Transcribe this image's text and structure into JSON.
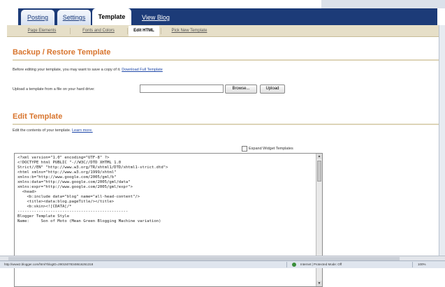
{
  "top_tabs": [
    {
      "label": "Posting"
    },
    {
      "label": "Settings"
    },
    {
      "label": "Template"
    }
  ],
  "view_blog_label": "View Blog",
  "sub_tabs": [
    {
      "label": "Page Elements"
    },
    {
      "label": "Fonts and Colors"
    },
    {
      "label": "Edit HTML"
    },
    {
      "label": "Pick New Template"
    }
  ],
  "backup": {
    "title": "Backup / Restore Template",
    "intro": "Before editing your template, you may want to save a copy of it.",
    "download_link": "Download Full Template",
    "upload_label": "Upload a template from a file on your hard drive:",
    "browse_label": "Browse...",
    "upload_button": "Upload"
  },
  "edit": {
    "title": "Edit Template",
    "intro": "Edit the contents of your template.",
    "learn_more": "Learn more.",
    "expand_label": "Expand Widget Templates",
    "code_lines": [
      "<?xml version=\"1.0\" encoding=\"UTF-8\" ?>",
      "<!DOCTYPE html PUBLIC \"-//W3C//DTD XHTML 1.0",
      "Strict//EN\" \"http://www.w3.org/TR/xhtml1/DTD/xhtml1-strict.dtd\">",
      "<html xmlns=\"http://www.w3.org/1999/xhtml\"",
      "xmlns:b=\"http://www.google.com/2005/gml/b\"",
      "xmlns:data=\"http://www.google.com/2005/gml/data\"",
      "xmlns:expr=\"http://www.google.com/2005/gml/expr\">",
      "  <head>",
      "    <b:include data=\"blog\" name=\"all-head-content\"/>",
      "    <title><data:blog.pageTitle/></title>",
      "    <b:skin><![CDATA[/*",
      "-----------------------------------------------",
      "Blogger Template Style",
      "Name:     Son of Moto (Mean Green Blogging Machine variation)"
    ]
  },
  "status": {
    "url": "http://www2.blogger.com/html?blogID=29015078348616261318",
    "zone": "Internet | Protected Mode: Off",
    "zoom": "100%"
  }
}
